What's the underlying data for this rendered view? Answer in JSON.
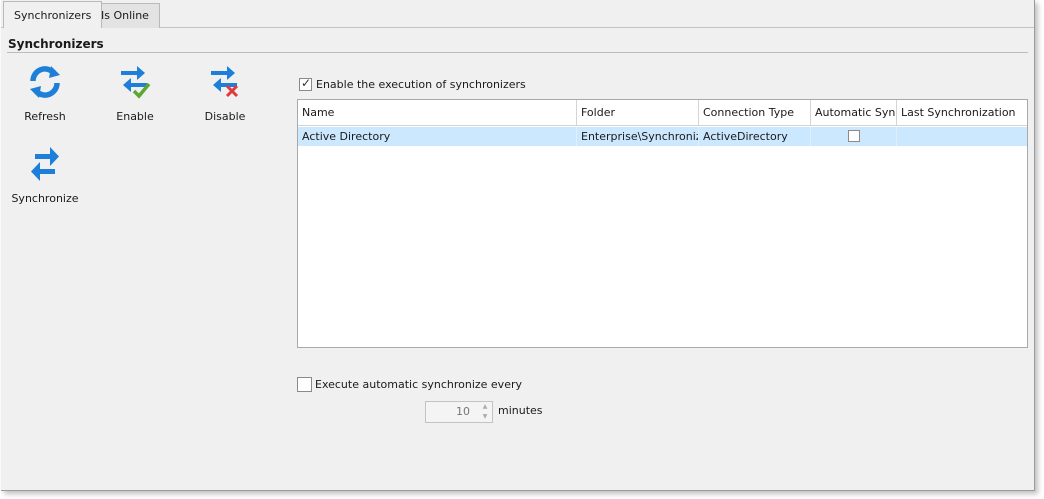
{
  "tabs": [
    {
      "label": "Synchronizers",
      "active": true
    },
    {
      "label": "Is Online",
      "active": false
    }
  ],
  "section": {
    "title": "Synchronizers"
  },
  "toolbar": {
    "refresh_label": "Refresh",
    "enable_label": "Enable",
    "disable_label": "Disable",
    "synchronize_label": "Synchronize"
  },
  "enable_execution": {
    "label": "Enable the execution of synchronizers",
    "checked": true
  },
  "grid": {
    "columns": [
      "Name",
      "Folder",
      "Connection Type",
      "Automatic Sync",
      "Last Synchronization"
    ],
    "rows": [
      {
        "name": "Active Directory",
        "folder": "Enterprise\\Synchronizer",
        "connection_type": "ActiveDirectory",
        "automatic_sync": false,
        "last_synchronization": ""
      }
    ]
  },
  "auto_sync": {
    "label": "Execute automatic synchronize every",
    "checked": false,
    "interval_value": "10",
    "unit_label": "minutes"
  },
  "colors": {
    "selected_row": "#cce8ff",
    "icon_blue": "#1e7fd8",
    "icon_green": "#5aa832",
    "icon_red": "#e0393e"
  }
}
